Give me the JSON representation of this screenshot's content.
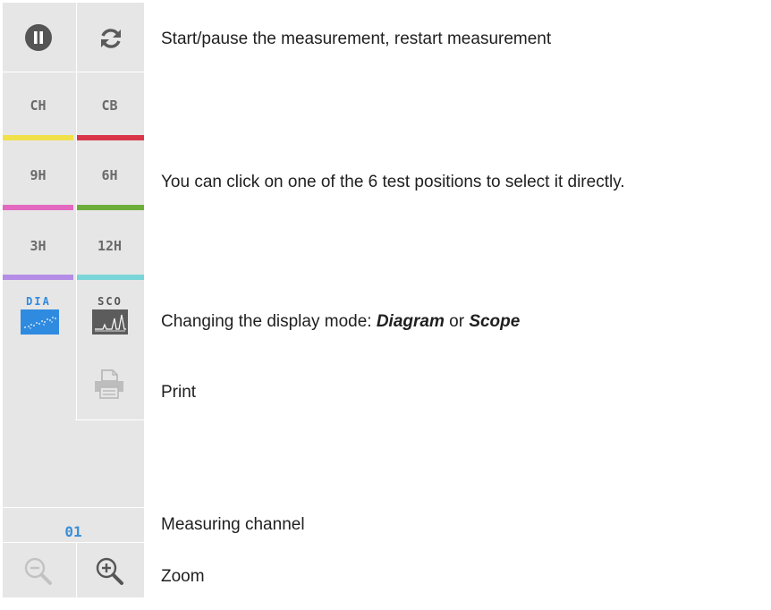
{
  "toolbar": {
    "play_pause": {
      "icon": "pause-circle-icon"
    },
    "restart": {
      "icon": "refresh-icon"
    },
    "positions": [
      {
        "label": "CH",
        "color": "#f0e04a"
      },
      {
        "label": "CB",
        "color": "#d9364a"
      },
      {
        "label": "9H",
        "color": "#e368c0"
      },
      {
        "label": "6H",
        "color": "#6cae3a"
      },
      {
        "label": "3H",
        "color": "#b48de6"
      },
      {
        "label": "12H",
        "color": "#7ad5d8"
      }
    ],
    "modes": {
      "diagram": {
        "label": "DIA",
        "icon": "diagram-icon",
        "color": "#2f8be0"
      },
      "scope": {
        "label": "SCO",
        "icon": "scope-icon"
      }
    },
    "print": {
      "icon": "printer-icon"
    },
    "channel": "01",
    "zoom_out": {
      "icon": "zoom-out-icon"
    },
    "zoom_in": {
      "icon": "zoom-in-icon"
    }
  },
  "descriptions": {
    "measurement": "Start/pause the measurement, restart measurement",
    "positions": "You can click on one of the 6 test positions to select it directly.",
    "display_mode_prefix": "Changing the display mode: ",
    "display_mode_diagram": "Diagram",
    "display_mode_or": " or ",
    "display_mode_scope": "Scope",
    "print": "Print",
    "channel": "Measuring channel",
    "zoom": "Zoom"
  }
}
